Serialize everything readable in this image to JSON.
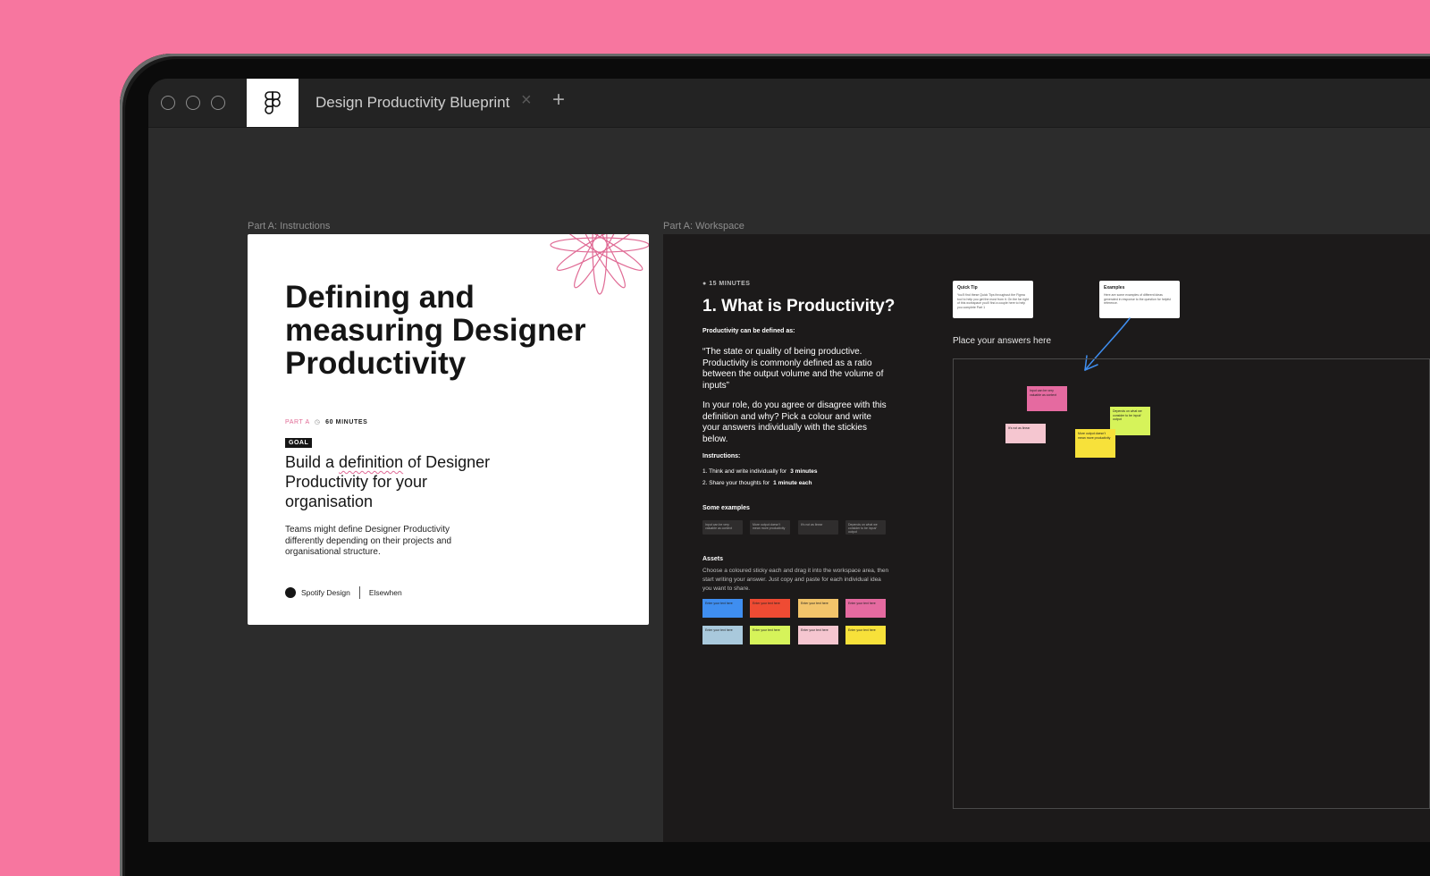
{
  "app": {
    "document_title": "Design Productivity Blueprint",
    "close_tab_icon": "close-icon",
    "new_tab_icon": "plus-icon"
  },
  "frames": {
    "instructions_label": "Part A: Instructions",
    "workspace_label": "Part A: Workspace"
  },
  "instructions": {
    "headline": "Defining and measuring Designer Productivity",
    "part": "PART A",
    "duration": "60 MINUTES",
    "goal_tag": "GOAL",
    "goal_pre": "Build a ",
    "goal_under": "definition",
    "goal_post": " of Designer Productivity for your organisation",
    "description": "Teams might define Designer Productivity differently depending on their projects and organisational structure.",
    "logo_spotify": "Spotify Design",
    "logo_elsewhen": "Elsewhen"
  },
  "workspace": {
    "time": "15 MINUTES",
    "title": "1. What is Productivity?",
    "definition_label": "Productivity can be defined as:",
    "quote": "“The state or quality of being productive. Productivity is commonly defined as a ratio between the output volume and the volume of inputs”",
    "question": "In your role, do you agree or disagree with this definition and why? Pick a colour and write your answers individually with the stickies below.",
    "instructions_label": "Instructions:",
    "step1": "1.  Think and write individually for",
    "step1_bold": "3 minutes",
    "step2": "2.  Share your thoughts for",
    "step2_bold": "1 minute each",
    "examples_label": "Some examples",
    "examples": [
      "Input can be very valuable as context",
      "More output doesn't mean more productivity",
      "It's not as linear",
      "Depends on what we consider to be input/ output"
    ],
    "assets_label": "Assets",
    "assets_desc": "Choose a coloured sticky each and drag it into the workspace area, then start writing your answer. Just copy and paste for each individual idea you want to share.",
    "sticky_text": "Enter your text here",
    "sticky_colors": [
      "#3f8ef0",
      "#ef4b33",
      "#f2c46a",
      "#e56aa0",
      "#a9c9dc",
      "#d6f35a",
      "#f5c6d0",
      "#f7e13a"
    ],
    "quick_tip_title": "Quick Tip",
    "quick_tip_body": "You'll find these Quick Tips throughout the Figma tool to help you get the most from it. On the far right of this workspace you'll find a couple here to help you complete Part 1",
    "examples_card_title": "Examples",
    "examples_card_body": "Here are some examples of different ideas generated in response to the question for helpful reference.",
    "place_answers": "Place your answers here",
    "notes": [
      {
        "text": "Input can be very valuable as context",
        "color": "#e56aa0"
      },
      {
        "text": "It's not as linear",
        "color": "#f5c6d0"
      },
      {
        "text": "Depends on what we consider to be input/ output",
        "color": "#d6f35a"
      },
      {
        "text": "More output doesn't mean more productivity",
        "color": "#f7e13a"
      }
    ]
  }
}
